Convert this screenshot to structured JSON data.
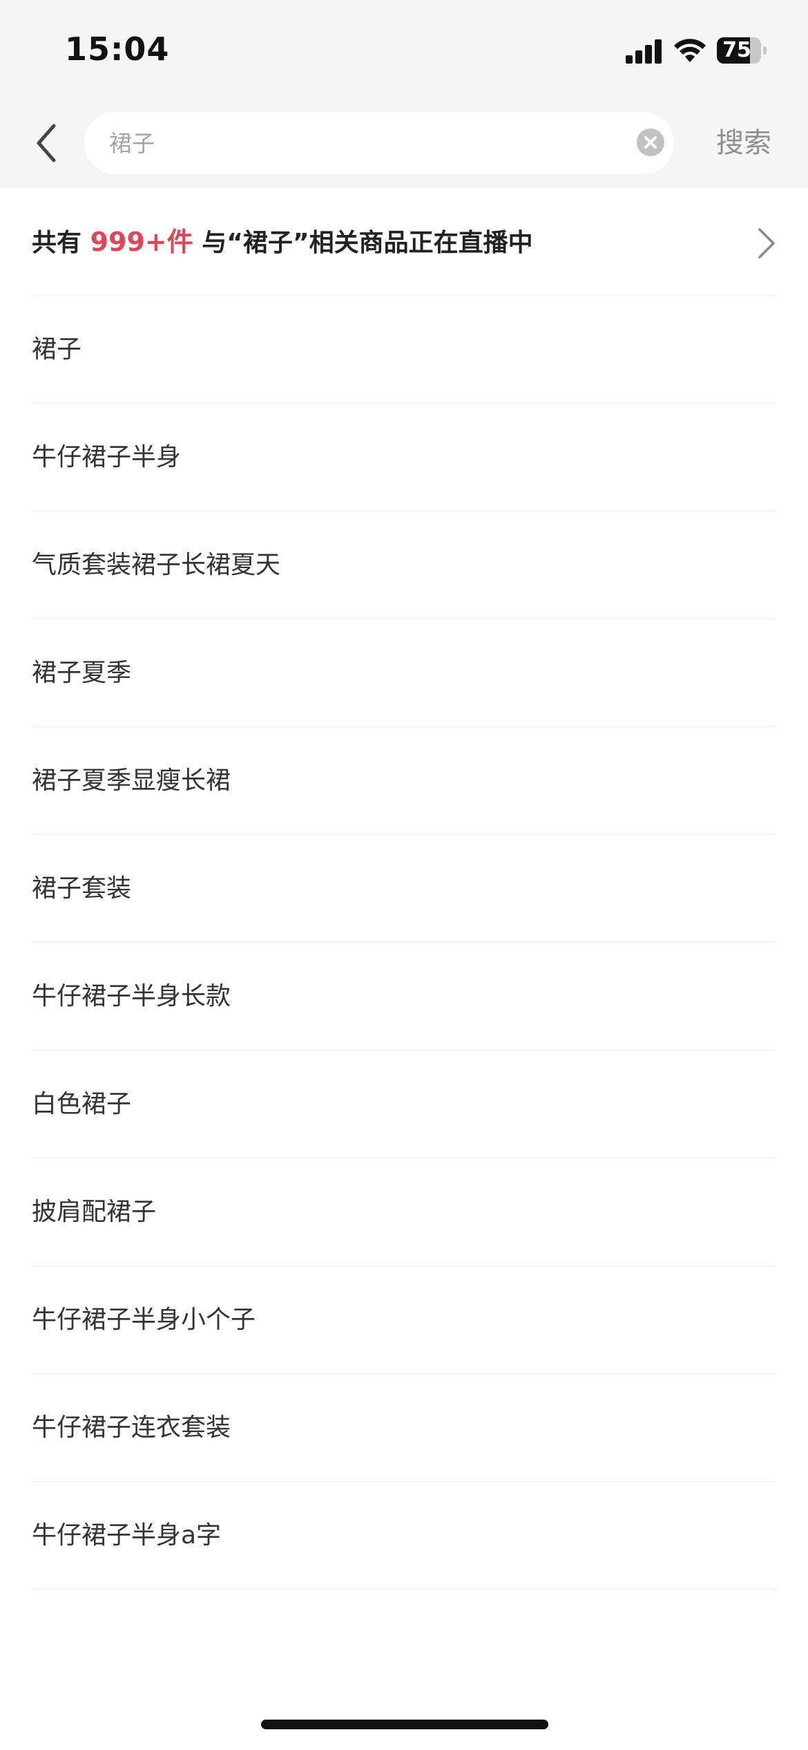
{
  "status_bar": {
    "time": "15:04",
    "battery_level": "75",
    "battery_fraction": 0.75,
    "signal_icon": "cellular-signal-icon",
    "wifi_icon": "wifi-icon"
  },
  "search": {
    "placeholder": "裙子",
    "value": "",
    "search_label": "搜索",
    "back_icon": "chevron-left-icon",
    "clear_icon": "clear-circle-icon"
  },
  "live_banner": {
    "prefix": "共有 ",
    "count": "999+件",
    "suffix": " 与“裙子”相关商品正在直播中",
    "accent_color": "#e0465a",
    "icon": "chevron-right-icon"
  },
  "suggestions": [
    "裙子",
    "牛仔裙子半身",
    "气质套装裙子长裙夏天",
    "裙子夏季",
    "裙子夏季显瘦长裙",
    "裙子套装",
    "牛仔裙子半身长款",
    "白色裙子",
    "披肩配裙子",
    "牛仔裙子半身小个子",
    "牛仔裙子连衣套装",
    "牛仔裙子半身a字"
  ]
}
